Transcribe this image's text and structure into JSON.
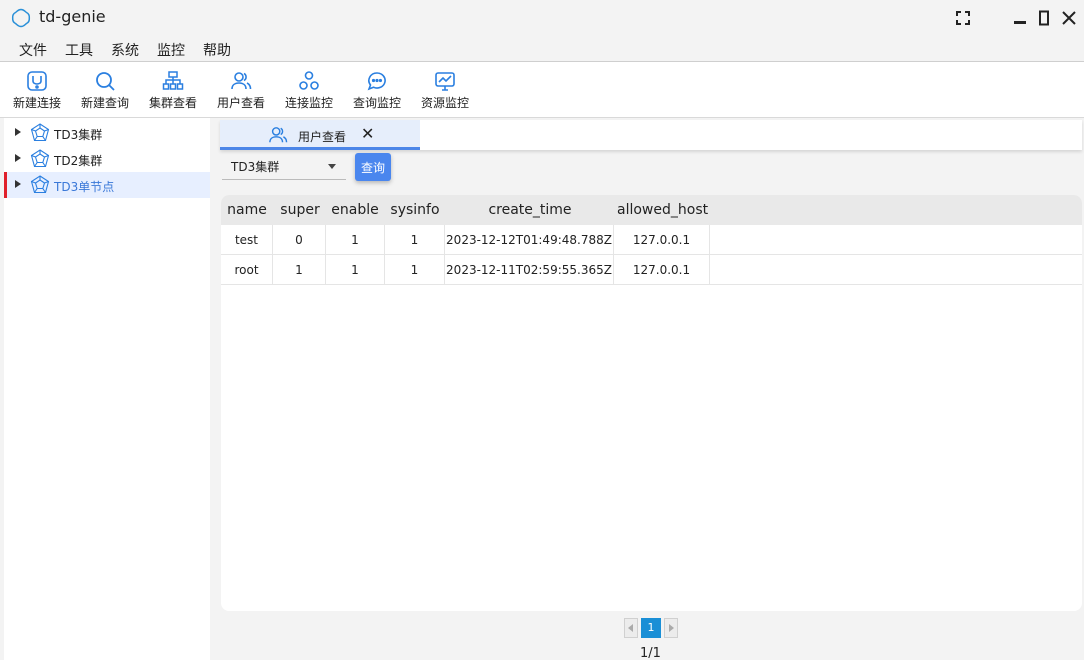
{
  "window": {
    "title": "td-genie"
  },
  "menu": [
    "文件",
    "工具",
    "系统",
    "监控",
    "帮助"
  ],
  "toolbar": [
    {
      "label": "新建连接",
      "icon": "new-connection-icon"
    },
    {
      "label": "新建查询",
      "icon": "search-icon"
    },
    {
      "label": "集群查看",
      "icon": "cluster-icon"
    },
    {
      "label": "用户查看",
      "icon": "users-icon"
    },
    {
      "label": "连接监控",
      "icon": "connection-monitor-icon"
    },
    {
      "label": "查询监控",
      "icon": "query-monitor-icon"
    },
    {
      "label": "资源监控",
      "icon": "resource-monitor-icon"
    }
  ],
  "tree": [
    {
      "label": "TD3集群",
      "selected": false
    },
    {
      "label": "TD2集群",
      "selected": false
    },
    {
      "label": "TD3单节点",
      "selected": true
    }
  ],
  "tab": {
    "label": "用户查看"
  },
  "filter": {
    "cluster": "TD3集群",
    "query_label": "查询"
  },
  "table": {
    "columns": [
      "name",
      "super",
      "enable",
      "sysinfo",
      "create_time",
      "allowed_host"
    ],
    "rows": [
      [
        "test",
        "0",
        "1",
        "1",
        "2023-12-12T01:49:48.788Z",
        "127.0.0.1"
      ],
      [
        "root",
        "1",
        "1",
        "1",
        "2023-12-11T02:59:55.365Z",
        "127.0.0.1"
      ]
    ]
  },
  "pagination": {
    "current": "1",
    "info": "1/1"
  },
  "colors": {
    "accent": "#4a86ee",
    "tab_underline": "#4c86e8",
    "selected_marker": "#e0202a",
    "page_active": "#1a8fd6"
  }
}
